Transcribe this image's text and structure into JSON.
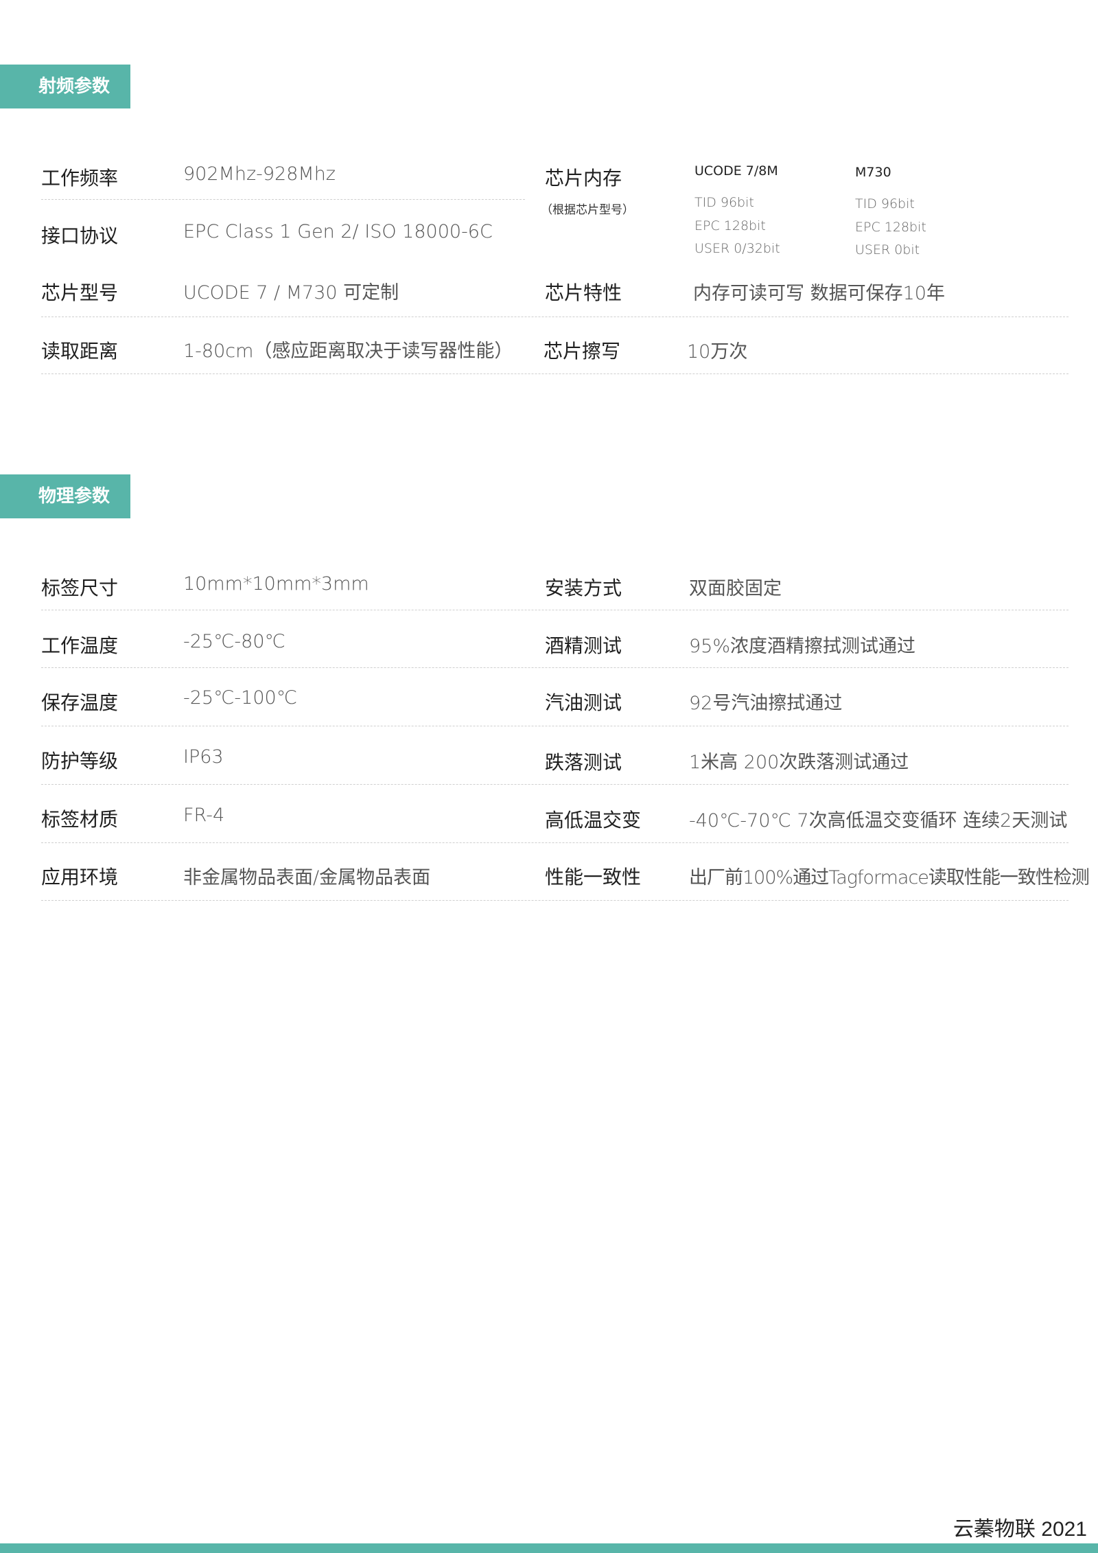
{
  "rf": {
    "tag": "射频参数",
    "rows": [
      {
        "label": "工作频率",
        "value": "902Mhz-928Mhz"
      },
      {
        "label": "接口协议",
        "value": "EPC Class 1 Gen 2/ ISO 18000-6C"
      },
      {
        "label": "芯片型号",
        "value": "UCODE 7 / M730 可定制"
      },
      {
        "label": "读取距离",
        "value": "1-80cm（感应距离取决于读写器性能）"
      }
    ],
    "memory": {
      "label": "芯片内存",
      "note": "（根据芯片型号）",
      "col1_head": "UCODE 7/8M",
      "col1_items": [
        "TID 96bit",
        "EPC 128bit",
        "USER 0/32bit"
      ],
      "col2_head": "M730",
      "col2_items": [
        "TID 96bit",
        "EPC 128bit",
        "USER 0bit"
      ]
    },
    "right_rows": [
      {
        "label": "芯片特性",
        "value": "内存可读可写 数据可保存10年"
      },
      {
        "label": "芯片擦写",
        "value": "10万次"
      }
    ]
  },
  "phys": {
    "tag": "物理参数",
    "left_rows": [
      {
        "label": "标签尺寸",
        "value": "10mm*10mm*3mm"
      },
      {
        "label": "工作温度",
        "value": "-25℃-80℃"
      },
      {
        "label": "保存温度",
        "value": "-25℃-100℃"
      },
      {
        "label": "防护等级",
        "value": "IP63"
      },
      {
        "label": "标签材质",
        "value": "FR-4"
      },
      {
        "label": "应用环境",
        "value": "非金属物品表面/金属物品表面"
      }
    ],
    "right_rows": [
      {
        "label": "安装方式",
        "value": "双面胶固定"
      },
      {
        "label": "酒精测试",
        "value": "95%浓度酒精擦拭测试通过"
      },
      {
        "label": "汽油测试",
        "value": "92号汽油擦拭通过"
      },
      {
        "label": "跌落测试",
        "value": "1米高 200次跌落测试通过"
      },
      {
        "label": "高低温交变",
        "value": "-40℃-70℃ 7次高低温交变循环 连续2天测试"
      },
      {
        "label": "性能一致性",
        "value": "出厂前100%通过Tagformace读取性能一致性检测"
      }
    ]
  },
  "footer": {
    "text": "云蓁物联 2021",
    "accent": "#58b5a9"
  }
}
